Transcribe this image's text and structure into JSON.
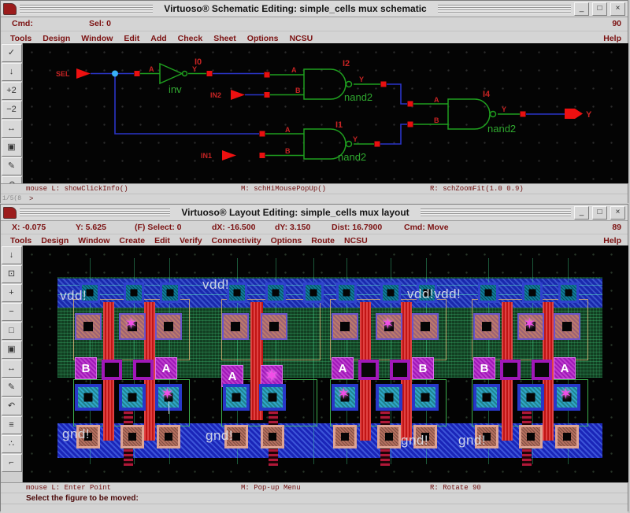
{
  "chrome": {
    "minimize": "_",
    "maximize": "□",
    "close": "×"
  },
  "schematic_window": {
    "title": "Virtuoso® Schematic Editing: simple_cells mux schematic",
    "status": {
      "cmd": "Cmd:",
      "sel": "Sel: 0",
      "counter": "90"
    },
    "menus": [
      "Tools",
      "Design",
      "Window",
      "Edit",
      "Add",
      "Check",
      "Sheet",
      "Options",
      "NCSU"
    ],
    "help": "Help",
    "toolbar": [
      {
        "name": "check-save-icon",
        "glyph": "✓"
      },
      {
        "name": "save-icon",
        "glyph": "↓"
      },
      {
        "name": "zoom-in-2x-icon",
        "glyph": "+2"
      },
      {
        "name": "zoom-out-2x-icon",
        "glyph": "−2"
      },
      {
        "name": "stretch-icon",
        "glyph": "↔"
      },
      {
        "name": "copy-icon",
        "glyph": "▣"
      },
      {
        "name": "wire-pen-icon",
        "glyph": "✎"
      },
      {
        "name": "undo-icon",
        "glyph": "↶"
      }
    ],
    "mouse_bar": {
      "left": "mouse L: showClickInfo()",
      "middle": "M: schHiMousePopUp()",
      "right": "R: schZoomFit(1.0 0.9)"
    },
    "prompt": ">",
    "iconified_label": "1/5(8",
    "canvas": {
      "pins": {
        "sel": "SEL",
        "in2": "IN2",
        "in1": "IN1",
        "out": "Y"
      },
      "gates": {
        "i0": {
          "name": "I0",
          "cell": "inv",
          "a": "A",
          "y": "Y"
        },
        "i2": {
          "name": "I2",
          "cell": "nand2",
          "a": "A",
          "b": "B",
          "y": "Y"
        },
        "i1": {
          "name": "I1",
          "cell": "nand2",
          "a": "A",
          "b": "B",
          "y": "Y"
        },
        "i4": {
          "name": "I4",
          "cell": "nand2",
          "a": "A",
          "b": "B",
          "y": "Y"
        }
      }
    }
  },
  "layout_window": {
    "title": "Virtuoso® Layout Editing: simple_cells mux layout",
    "status": {
      "x": "X: -0.075",
      "y": "Y: 5.625",
      "select": "(F) Select: 0",
      "dx": "dX: -16.500",
      "dy": "dY: 3.150",
      "dist": "Dist: 16.7900",
      "cmd": "Cmd: Move",
      "counter": "89"
    },
    "menus": [
      "Tools",
      "Design",
      "Window",
      "Create",
      "Edit",
      "Verify",
      "Connectivity",
      "Options",
      "Route",
      "NCSU"
    ],
    "help": "Help",
    "toolbar": [
      {
        "name": "save-icon",
        "glyph": "↓"
      },
      {
        "name": "zoom-fit-icon",
        "glyph": "⊡"
      },
      {
        "name": "zoom-in-icon",
        "glyph": "+"
      },
      {
        "name": "zoom-out-icon",
        "glyph": "−"
      },
      {
        "name": "rectangle-icon",
        "glyph": "□"
      },
      {
        "name": "copy-icon",
        "glyph": "▣"
      },
      {
        "name": "stretch-icon",
        "glyph": "↔"
      },
      {
        "name": "pen-icon",
        "glyph": "✎"
      },
      {
        "name": "undo-icon",
        "glyph": "↶"
      },
      {
        "name": "ruler-icon",
        "glyph": "≡"
      },
      {
        "name": "instances-icon",
        "glyph": "∴"
      },
      {
        "name": "path-icon",
        "glyph": "⌐"
      }
    ],
    "mouse_bar": {
      "left": "mouse L: Enter Point",
      "middle": "M: Pop-up Menu",
      "right": "R: Rotate 90"
    },
    "prompt": "Select the figure to be moved:",
    "rails": {
      "vdd_left": "vdd!",
      "vdd_mid": "vdd!",
      "vdd_right": "vdd!vdd!",
      "gnd_1": "gnd!",
      "gnd_2": "gnd!",
      "gnd_3": "gnd!",
      "gnd_4": "gnd!"
    },
    "cells": [
      {
        "type": "nand2",
        "labels": [
          "B",
          "A"
        ]
      },
      {
        "type": "inv",
        "labels": [
          "A"
        ]
      },
      {
        "type": "nand2",
        "labels": [
          "A",
          "B"
        ]
      },
      {
        "type": "nand2",
        "labels": [
          "B",
          "A"
        ]
      }
    ],
    "colors": {
      "metal1_rail": "#1a25b8",
      "nwell": "#123f22",
      "poly": "#c01515",
      "pdiff_contact": "#bd7a6b",
      "ndiff_contact": "#2fa6c8",
      "label_box": "#a018b8",
      "rail_text": "#dfe3ea",
      "chrome_text": "#7c1212"
    }
  }
}
